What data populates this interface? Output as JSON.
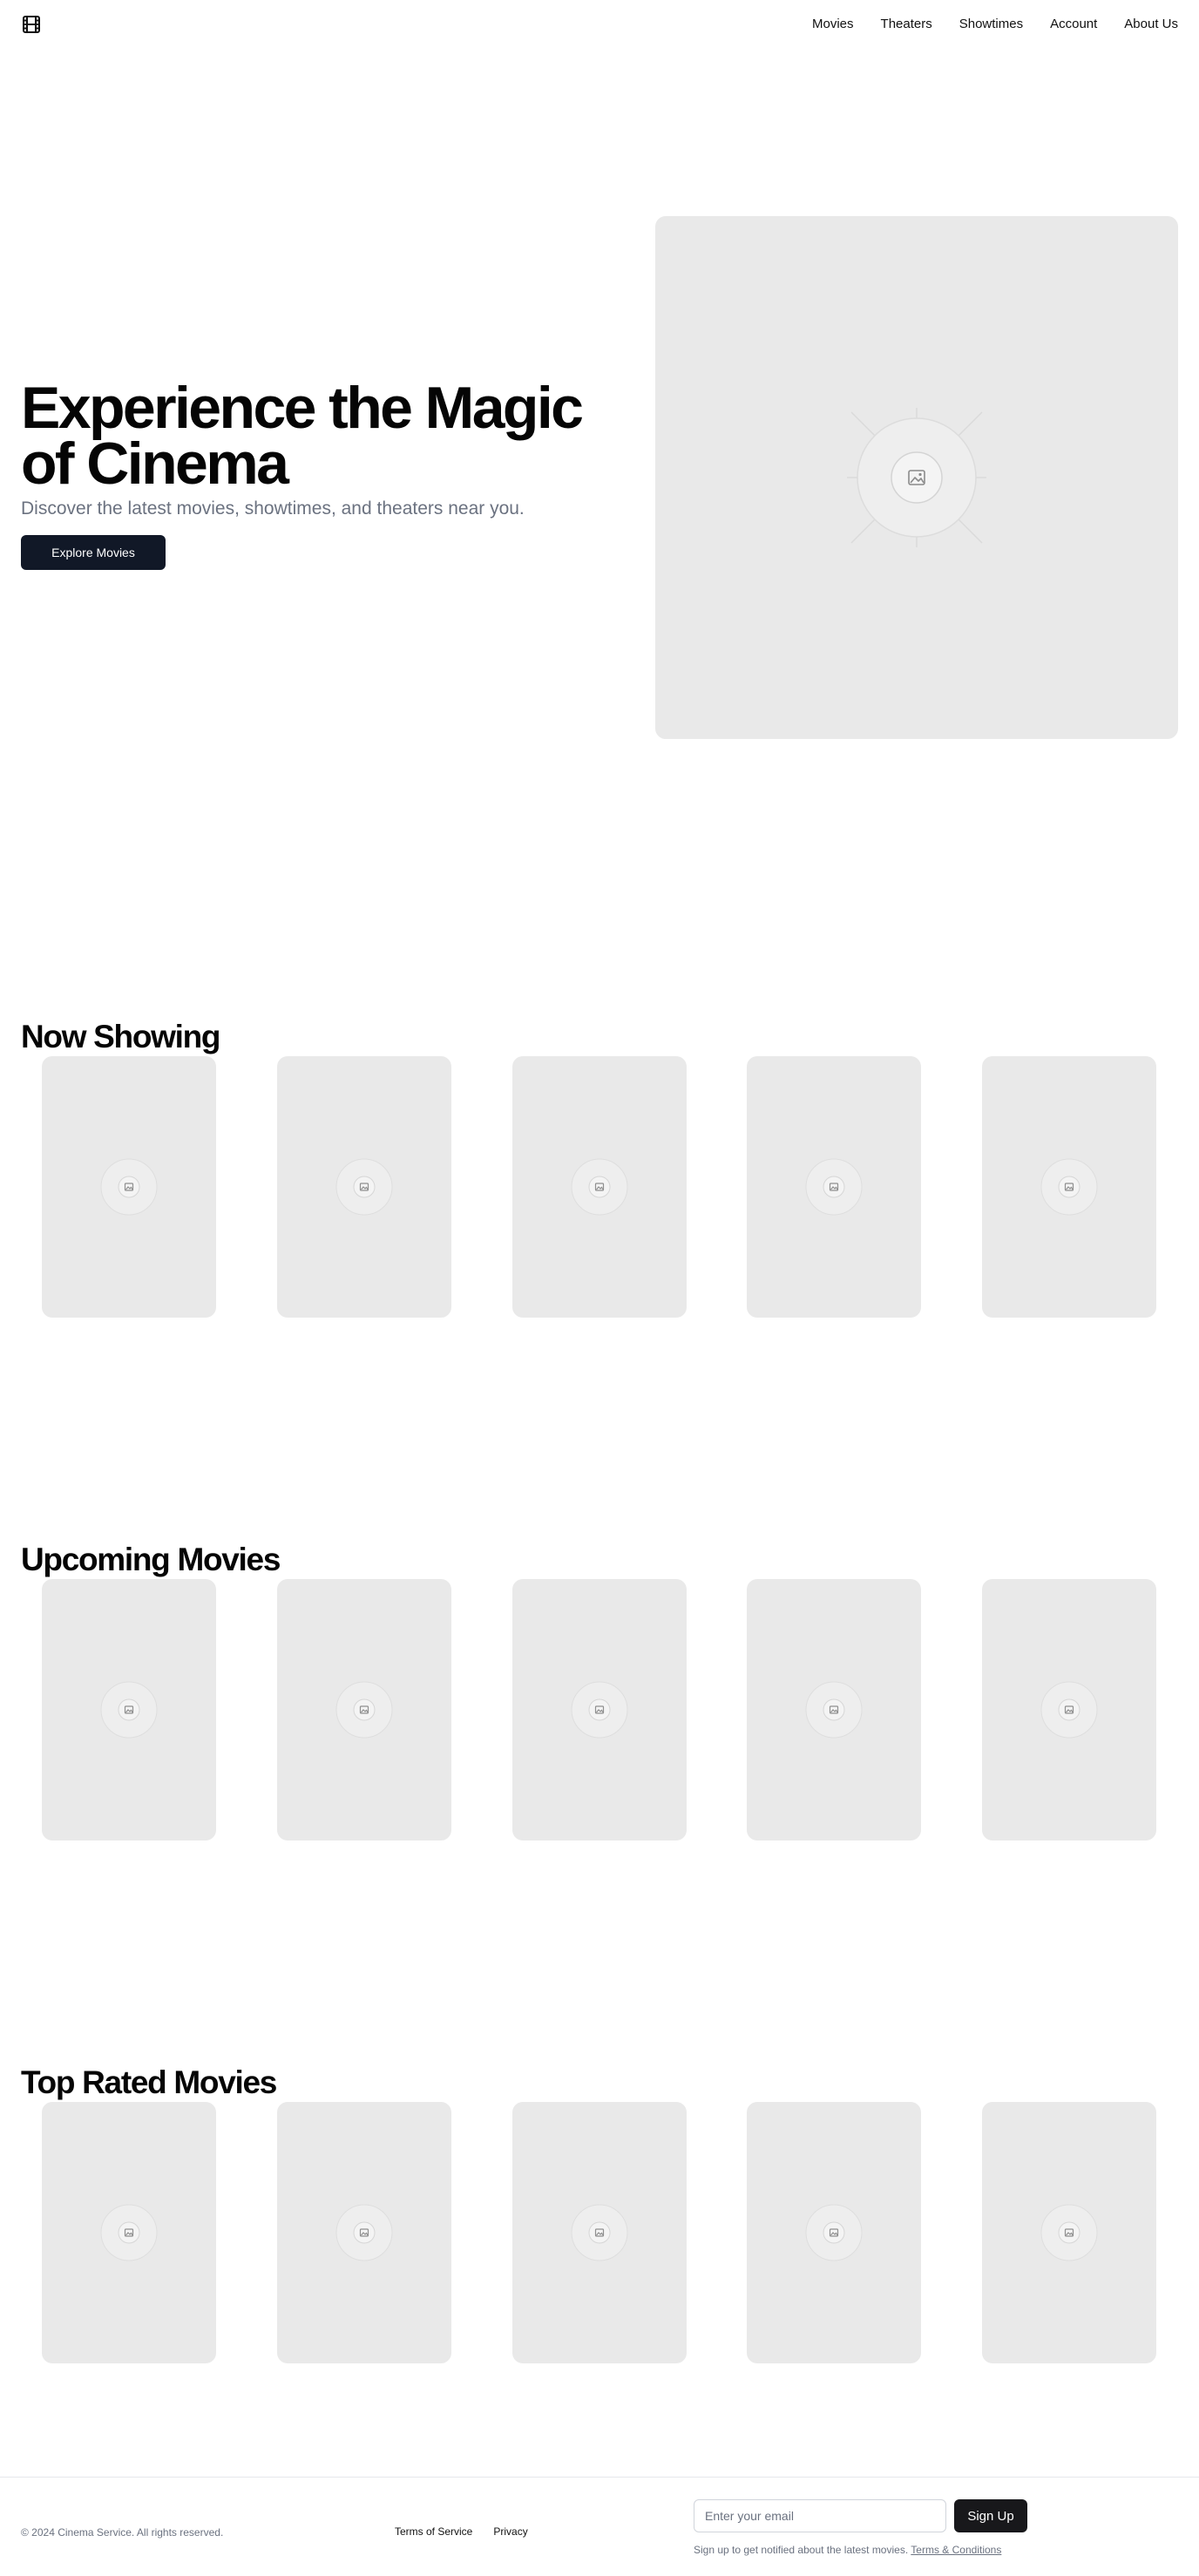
{
  "header": {
    "logo_icon": "film-icon",
    "nav": [
      "Movies",
      "Theaters",
      "Showtimes",
      "Account",
      "About Us"
    ]
  },
  "hero": {
    "title": "Experience the Magic of Cinema",
    "subtitle": "Discover the latest movies, showtimes, and theaters near you.",
    "button_label": "Explore Movies",
    "image_icon": "image-placeholder-icon"
  },
  "sections": [
    {
      "title": "Now Showing",
      "poster_count": 5
    },
    {
      "title": "Upcoming Movies",
      "poster_count": 5
    },
    {
      "title": "Top Rated Movies",
      "poster_count": 5
    }
  ],
  "footer": {
    "copyright": "© 2024 Cinema Service. All rights reserved.",
    "links": [
      "Terms of Service",
      "Privacy"
    ],
    "email_placeholder": "Enter your email",
    "signup_label": "Sign Up",
    "note_text": "Sign up to get notified about the latest movies.",
    "note_link": "Terms & Conditions"
  },
  "colors": {
    "primary_button": "#111827",
    "signup_button": "#18181b",
    "placeholder_bg": "#e9e9e9",
    "muted_text": "#6b7280"
  }
}
